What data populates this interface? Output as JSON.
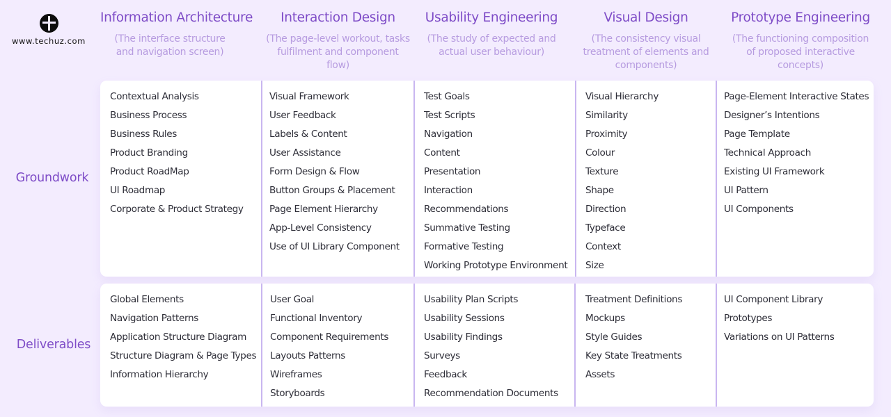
{
  "brand": {
    "site": "www.techuz.com",
    "logo_icon": "circle-cross-logo-icon"
  },
  "columns": [
    {
      "title": "Information Architecture",
      "description": "(The interface structure and navigation screen)"
    },
    {
      "title": "Interaction Design",
      "description": "(The page-level workout, tasks fulfilment and component flow)"
    },
    {
      "title": "Usability Engineering",
      "description": "(The study of expected and actual user behaviour)"
    },
    {
      "title": "Visual Design",
      "description": "(The consistency visual treatment of elements and components)"
    },
    {
      "title": "Prototype Engineering",
      "description": "(The functioning composition of proposed interactive concepts)"
    }
  ],
  "rows": [
    {
      "label": "Groundwork",
      "cells": [
        [
          "Contextual Analysis",
          "Business Process",
          "Business Rules",
          "Product Branding",
          "Product RoadMap",
          "UI Roadmap",
          "Corporate & Product Strategy"
        ],
        [
          "Visual Framework",
          "User Feedback",
          "Labels & Content",
          "User Assistance",
          "Form Design & Flow",
          "Button Groups & Placement",
          "Page Element Hierarchy",
          "App-Level Consistency",
          "Use of UI Library Component"
        ],
        [
          "Test Goals",
          "Test Scripts",
          "Navigation",
          "Content",
          "Presentation",
          "Interaction",
          "Recommendations",
          "Summative Testing",
          "Formative Testing",
          "Working Prototype Environment"
        ],
        [
          "Visual Hierarchy",
          "Similarity",
          "Proximity",
          "Colour",
          "Texture",
          "Shape",
          "Direction",
          "Typeface",
          "Context",
          "Size"
        ],
        [
          "Page-Element Interactive States",
          "Designer’s Intentions",
          "Page Template",
          "Technical Approach",
          "Existing UI Framework",
          "UI Pattern",
          "UI Components"
        ]
      ]
    },
    {
      "label": "Deliverables",
      "cells": [
        [
          "Global Elements",
          "Navigation Patterns",
          "Application Structure Diagram",
          "Structure Diagram & Page Types",
          "Information Hierarchy"
        ],
        [
          "User Goal",
          "Functional Inventory",
          "Component Requirements",
          "Layouts Patterns",
          "Wireframes",
          "Storyboards"
        ],
        [
          "Usability Plan Scripts",
          "Usability Sessions",
          "Usability Findings",
          "Surveys",
          "Feedback",
          "Recommendation Documents"
        ],
        [
          "Treatment Definitions",
          "Mockups",
          "Style Guides",
          "Key State Treatments",
          "Assets"
        ],
        [
          "UI Component Library",
          "Prototypes",
          "Variations on UI Patterns"
        ]
      ]
    }
  ],
  "colors": {
    "background": "#f3ecfe",
    "accent": "#7e4cc7",
    "description": "#b79ce0",
    "divider": "#c9b6f0",
    "item_text": "#2e2e38"
  }
}
